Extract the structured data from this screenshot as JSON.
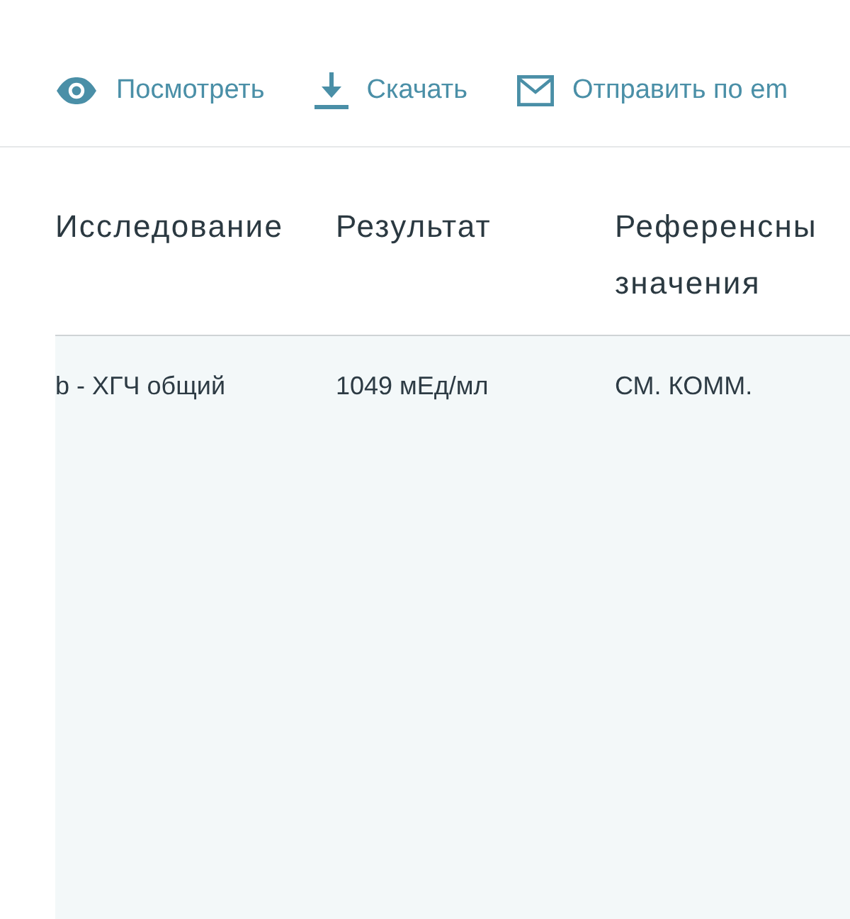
{
  "actions": [
    {
      "kind": "view",
      "label": "Посмотреть"
    },
    {
      "kind": "download",
      "label": "Скачать"
    },
    {
      "kind": "email",
      "label": "Отправить по em"
    }
  ],
  "table": {
    "columns": [
      "Исследование",
      "Результат",
      "Референсны значения"
    ],
    "rows": [
      [
        "b - ХГЧ общий",
        "1049 мЕд/мл",
        "СМ. КОММ."
      ]
    ]
  }
}
